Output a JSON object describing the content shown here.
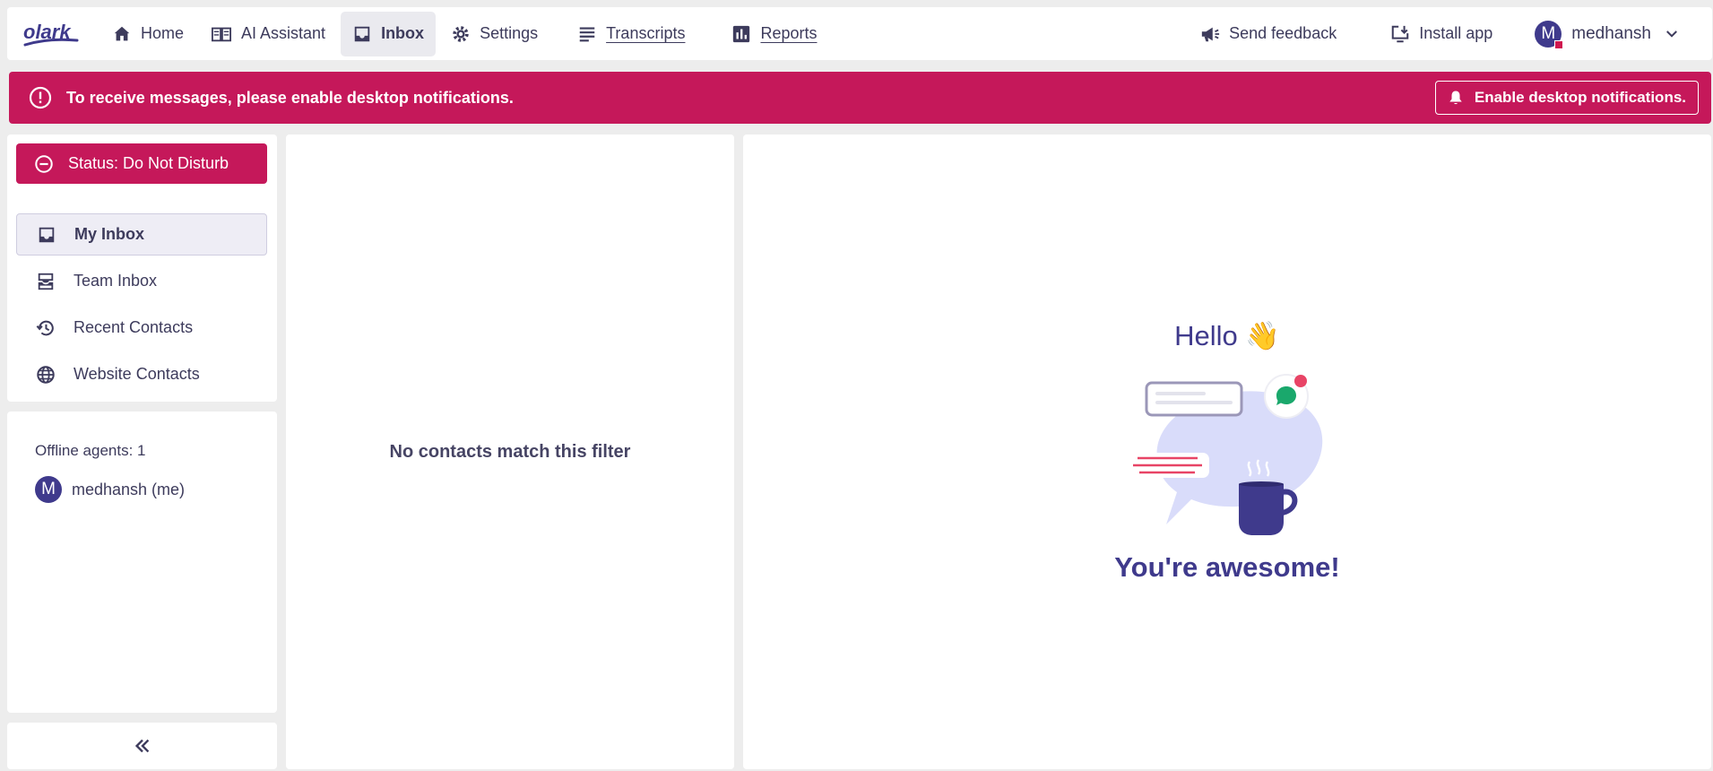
{
  "app": {
    "logo_text": "olark"
  },
  "nav": {
    "home": "Home",
    "ai_assistant": "AI Assistant",
    "inbox": "Inbox",
    "settings": "Settings",
    "transcripts": "Transcripts",
    "reports": "Reports",
    "send_feedback": "Send feedback",
    "install_app": "Install app",
    "user_initial": "M",
    "user_name": "medhansh"
  },
  "banner": {
    "message": "To receive messages, please enable desktop notifications.",
    "button": "Enable desktop notifications."
  },
  "sidebar": {
    "status": "Status: Do Not Disturb",
    "items": [
      {
        "label": "My Inbox",
        "icon": "inbox-icon"
      },
      {
        "label": "Team Inbox",
        "icon": "team-inbox-icon"
      },
      {
        "label": "Recent Contacts",
        "icon": "history-icon"
      },
      {
        "label": "Website Contacts",
        "icon": "globe-icon"
      }
    ],
    "offline_agents": "Offline agents: 1",
    "agent_initial": "M",
    "agent_name": "medhansh (me)",
    "collapse": "«"
  },
  "contacts": {
    "empty": "No contacts match this filter"
  },
  "main": {
    "hello": "Hello 👋",
    "awesome": "You're awesome!"
  },
  "colors": {
    "brand": "#c5185a",
    "accent": "#3f3a8c",
    "text": "#3d3b5c"
  }
}
